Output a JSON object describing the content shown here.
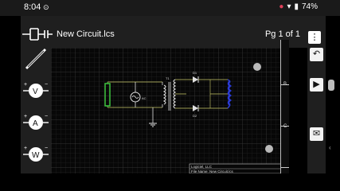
{
  "status": {
    "time": "8:04",
    "battery": "74%"
  },
  "app": {
    "title": "New Circuit.lcs",
    "page_indicator": "Pg 1 of 1"
  },
  "tools": [
    {
      "name": "wire-tool"
    },
    {
      "name": "voltmeter-tool",
      "label": "V"
    },
    {
      "name": "ammeter-tool",
      "label": "A"
    },
    {
      "name": "wattmeter-tool",
      "label": "W"
    }
  ],
  "ruler": {
    "labels": [
      "B",
      "C"
    ]
  },
  "circuit": {
    "labels": {
      "d1": "D1",
      "d2": "D2",
      "t1": "T1"
    }
  },
  "title_block": {
    "company": "Logiciel, LLC",
    "file_name": "File Name: New Circuit.lcs"
  }
}
